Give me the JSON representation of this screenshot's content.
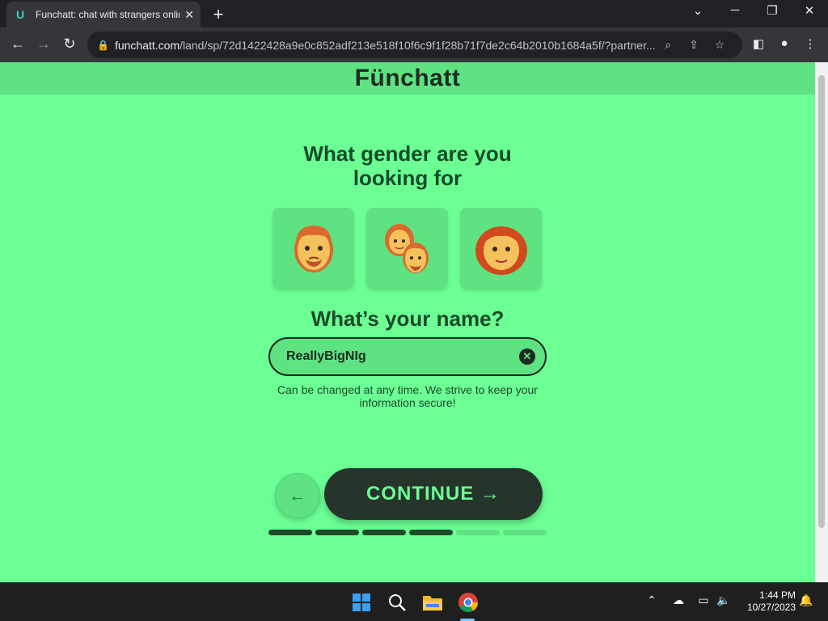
{
  "browser": {
    "tab_title": "Funchatt: chat with strangers online",
    "tab_close": "✕",
    "new_tab": "+",
    "url_domain": "funchatt.com",
    "url_path": "/land/sp/72d1422428a9e0c852adf213e518f10f6c9f1f28b71f7de2c64b2010b1684a5f/?partner..."
  },
  "page": {
    "logo": "Fünchatt",
    "question_gender": "What gender are you looking for",
    "gender_options": [
      {
        "icon": "man-emoji-icon"
      },
      {
        "icon": "couple-emoji-icon"
      },
      {
        "icon": "woman-emoji-icon"
      }
    ],
    "question_name": "What’s your name?",
    "name_value": "ReallyBigNIg",
    "clear_label": "✕",
    "hint": "Can be changed at any time. We strive to keep your information secure!",
    "back_label": "←",
    "continue_label": "CONTINUE →",
    "progress": {
      "completed_steps": 4,
      "total_steps": 6
    }
  },
  "taskbar": {
    "time": "1:44 PM",
    "date": "10/27/2023"
  },
  "colors": {
    "page_bg": "#6bff94",
    "header_bg": "#5fe281",
    "dark_text": "#1e2a22",
    "continue_bg": "#26352b"
  }
}
